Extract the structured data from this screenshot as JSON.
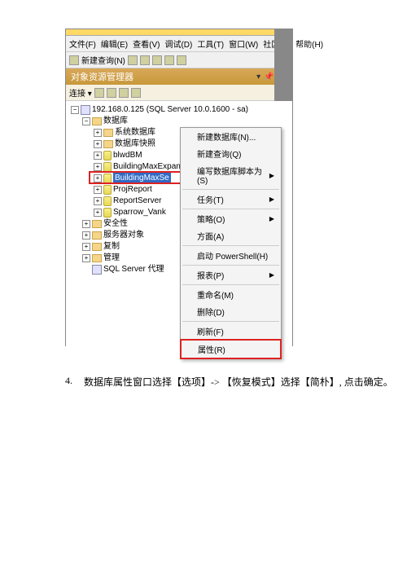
{
  "menubar": {
    "file": "文件(F)",
    "edit": "编辑(E)",
    "view": "查看(V)",
    "debug": "调试(D)",
    "tools": "工具(T)",
    "window": "窗口(W)",
    "community": "社区(C)",
    "help": "帮助(H)"
  },
  "toolbar": {
    "newquery": "新建查询(N)"
  },
  "panel": {
    "title": "对象资源管理器",
    "connect": "连接 ▾"
  },
  "tree": {
    "server": "192.168.0.125 (SQL Server 10.0.1600 - sa)",
    "databases": "数据库",
    "sysdb": "系统数据库",
    "snapshot": "数据库快照",
    "blwdBM": "blwdBM",
    "bmExpand": "BuildingMaxExpand",
    "bmSel": "BuildingMaxSe",
    "proj": "ProjReport",
    "report": "ReportServer",
    "sparrow": "Sparrow_Vank",
    "security": "安全性",
    "serverobj": "服务器对象",
    "replication": "复制",
    "management": "管理",
    "agent": "SQL Server 代理"
  },
  "ctx": {
    "newdb": "新建数据库(N)...",
    "newquery": "新建查询(Q)",
    "script": "编写数据库脚本为(S)",
    "tasks": "任务(T)",
    "policies": "策略(O)",
    "facets": "方面(A)",
    "powershell": "启动 PowerShell(H)",
    "reports": "报表(P)",
    "rename": "重命名(M)",
    "delete": "删除(D)",
    "refresh": "刷新(F)",
    "properties": "属性(R)"
  },
  "caption": {
    "num": "4.",
    "text": "数据库属性窗口选择【选项】-> 【恢复模式】选择【简朴】, 点击确定。"
  }
}
